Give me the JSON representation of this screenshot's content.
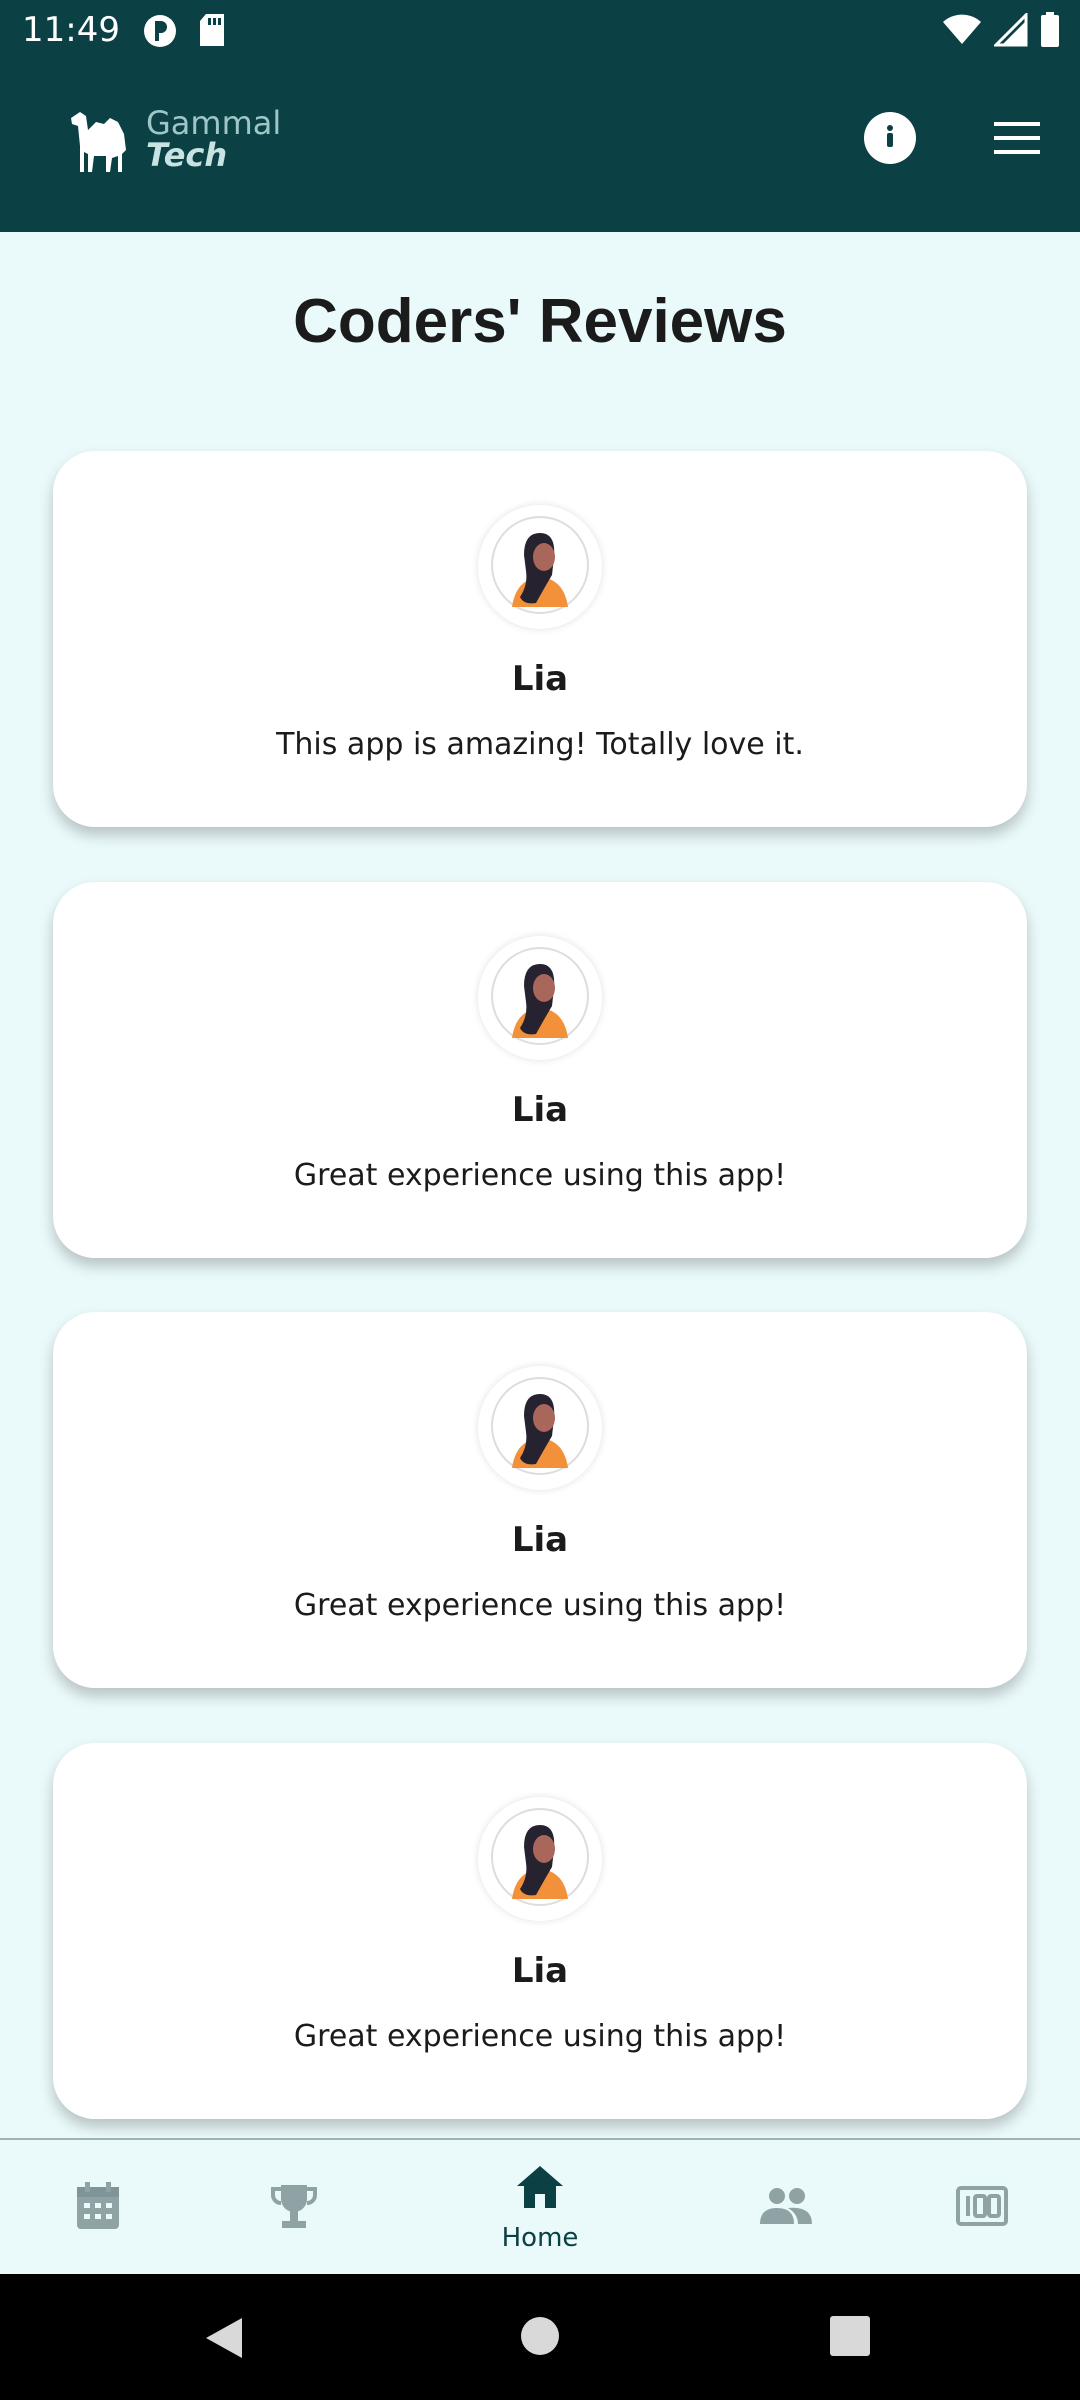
{
  "status_bar": {
    "time": "11:49",
    "left_icons": [
      "data-saver-icon",
      "sd-card-icon"
    ],
    "right_icons": [
      "wifi-icon",
      "signal-icon",
      "battery-icon"
    ]
  },
  "header": {
    "logo_line1": "Gammal",
    "logo_line2": "Tech",
    "info_icon": "info-icon",
    "menu_icon": "hamburger-menu-icon",
    "background": "#0B4044"
  },
  "page": {
    "title": "Coders' Reviews"
  },
  "reviews": [
    {
      "name": "Lia",
      "text": "This app is amazing! Totally love it."
    },
    {
      "name": "Lia",
      "text": "Great experience using this app!"
    },
    {
      "name": "Lia",
      "text": "Great experience using this app!"
    },
    {
      "name": "Lia",
      "text": "Great experience using this app!"
    }
  ],
  "bottom_nav": {
    "items": [
      {
        "icon": "calendar-icon",
        "label": ""
      },
      {
        "icon": "trophy-icon",
        "label": ""
      },
      {
        "icon": "home-icon",
        "label": "Home",
        "active": true
      },
      {
        "icon": "people-icon",
        "label": ""
      },
      {
        "icon": "scoreboard-icon",
        "label": ""
      }
    ],
    "active_color": "#0B4044",
    "inactive_color": "#8FA3A5"
  },
  "system_nav": [
    "back-icon",
    "home-circle-icon",
    "recents-icon"
  ]
}
